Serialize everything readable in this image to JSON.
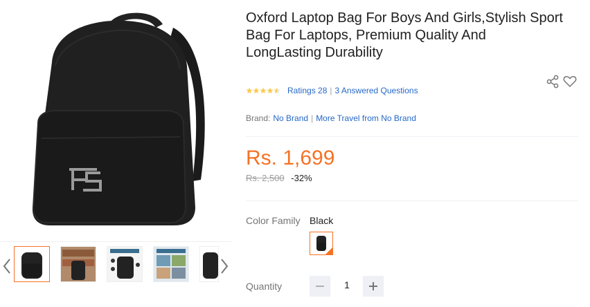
{
  "product": {
    "title": "Oxford Laptop Bag For Boys And Girls,Stylish Sport Bag For Laptops, Premium Quality And LongLasting Durability",
    "rating_stars": 4.5,
    "ratings_label": "Ratings 28",
    "questions_label": "3 Answered Questions",
    "brand_label": "Brand:",
    "brand_value": "No Brand",
    "more_from": "More Travel from No Brand",
    "price": "Rs. 1,699",
    "original_price": "Rs. 2,500",
    "discount": "-32%"
  },
  "variant": {
    "color_label": "Color Family",
    "color_value": "Black"
  },
  "quantity": {
    "label": "Quantity",
    "value": "1"
  },
  "icons": {
    "share": "share-icon",
    "wishlist": "heart-icon",
    "prev": "chevron-left-icon",
    "next": "chevron-right-icon",
    "minus": "minus-icon",
    "plus": "plus-icon"
  },
  "colors": {
    "accent": "#f57224",
    "link": "#2668c8",
    "star": "#faca51"
  }
}
